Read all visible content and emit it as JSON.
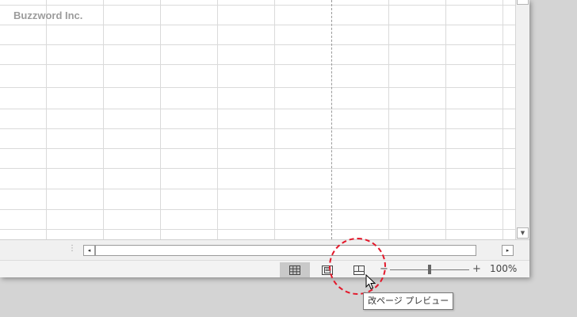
{
  "sheet": {
    "watermark": "Buzzword Inc."
  },
  "hscroll": {
    "left_arrow": "◂",
    "right_arrow": "▸",
    "splitter": "⋮"
  },
  "vscroll": {
    "down_arrow": "▼"
  },
  "status_bar": {
    "view_buttons": [
      {
        "name": "normal-view",
        "icon": "grid-icon",
        "active": true
      },
      {
        "name": "page-layout-view",
        "icon": "page-layout-icon",
        "active": false
      },
      {
        "name": "page-break-preview",
        "icon": "page-break-icon",
        "active": false
      }
    ],
    "zoom_minus": "−",
    "zoom_plus": "+",
    "zoom_level": "100%",
    "zoom_fraction": 0.5
  },
  "tooltip": {
    "text": "改ページ プレビュー"
  },
  "colors": {
    "highlight": "#e3182a",
    "grid": "#dadada"
  }
}
